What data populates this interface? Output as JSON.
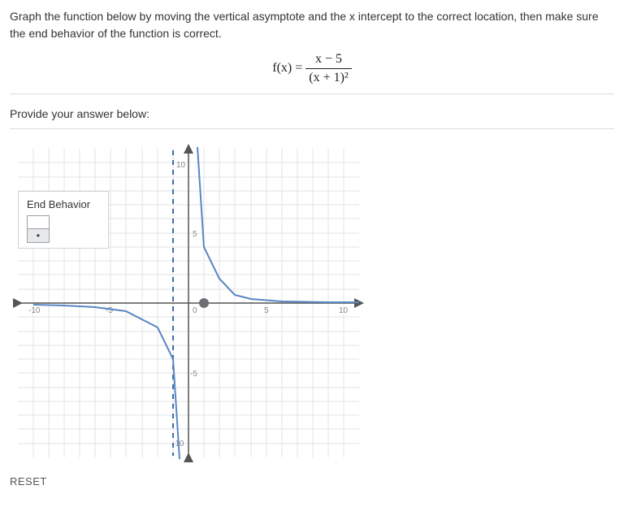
{
  "instructions": "Graph the function below by moving the vertical asymptote and the x intercept to the correct location, then make sure the end behavior of the function is correct.",
  "equation": {
    "lhs": "f(x) = ",
    "numerator": "x − 5",
    "denominator": "(x + 1)²"
  },
  "answer_label": "Provide your answer below:",
  "end_behavior": {
    "title": "End Behavior"
  },
  "axes": {
    "xmin": -10,
    "xmax": 10,
    "ymin": -10,
    "ymax": 10,
    "x_neg": "-10",
    "x_pos": "10",
    "y_neg": "-10",
    "y_pos": "10",
    "tick_neg5": "-5",
    "tick_5": "5",
    "origin": "0"
  },
  "graph_state": {
    "asymptote_x": 0,
    "x_intercept": 1
  },
  "reset_label": "RESET",
  "chart_data": {
    "type": "line",
    "title": "",
    "xlabel": "",
    "ylabel": "",
    "xlim": [
      -10,
      10
    ],
    "ylim": [
      -10,
      10
    ],
    "series": [
      {
        "name": "curve-left",
        "x": [
          -10,
          -8,
          -6,
          -4,
          -2,
          -1,
          -0.6,
          -0.4,
          -0.3
        ],
        "y": [
          -0.11,
          -0.17,
          -0.28,
          -0.56,
          -1.75,
          -4,
          -11.1,
          -25,
          -44.4
        ]
      },
      {
        "name": "curve-right",
        "x": [
          0.3,
          0.4,
          0.6,
          1,
          2,
          4,
          6,
          8,
          10
        ],
        "y": [
          44.4,
          25,
          11.1,
          4,
          1.75,
          0.56,
          0.28,
          0.17,
          0.11
        ]
      }
    ],
    "vertical_asymptote": 0,
    "horizontal_asymptote": 0,
    "x_intercept": 1
  }
}
